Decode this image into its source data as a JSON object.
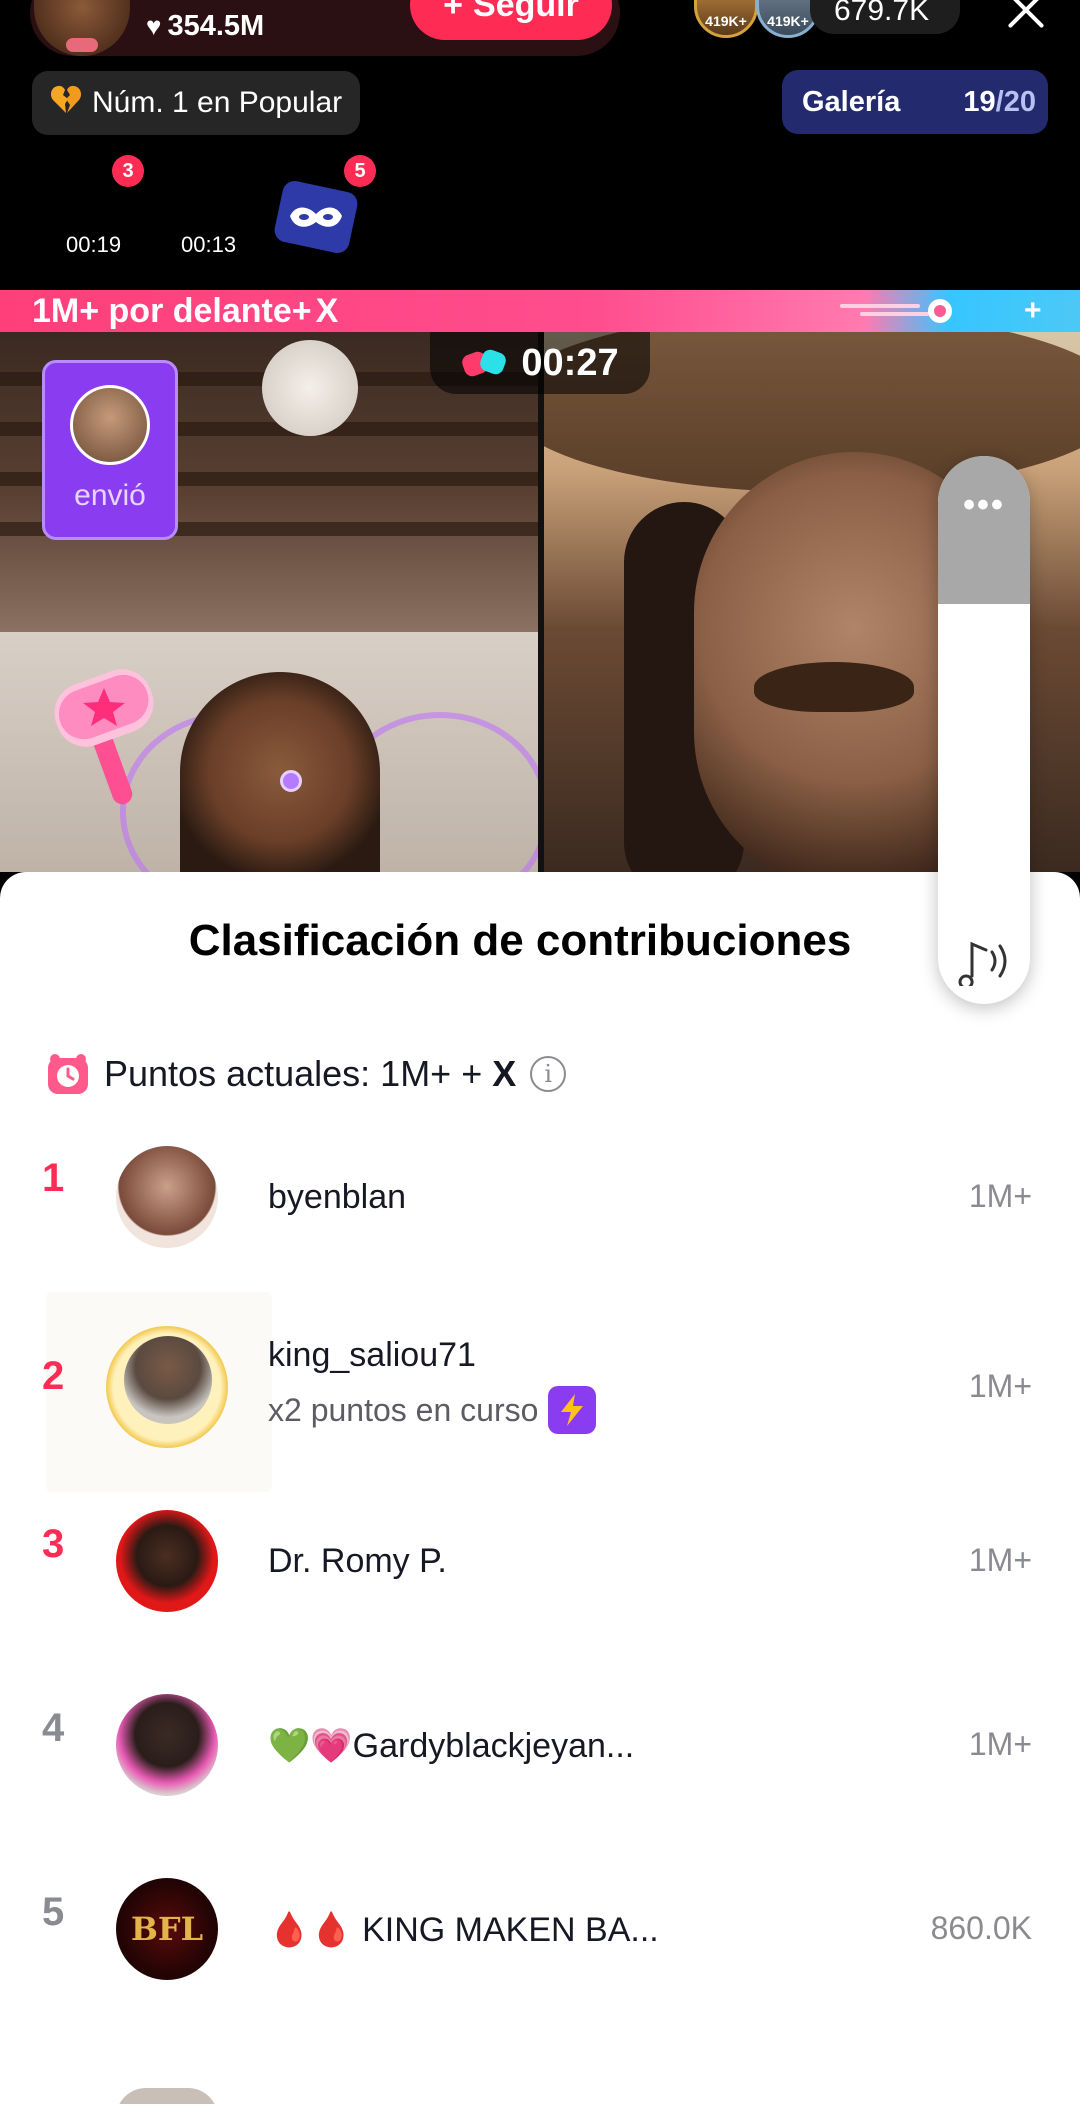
{
  "host": {
    "likes": "354.5M",
    "follow_label": "Seguir"
  },
  "viewers": {
    "badge_1": "419K+",
    "badge_2": "419K+",
    "count": "679.7K"
  },
  "popular_badge": {
    "label": "Núm. 1 en Popular"
  },
  "gallery": {
    "label": "Galería",
    "current": "19",
    "separator": "/",
    "total": "20"
  },
  "gift_timers": [
    {
      "time": "00:19",
      "badge": "3"
    },
    {
      "time": "00:13"
    },
    {
      "badge": "5",
      "icon": "mask-icon"
    }
  ],
  "progress_banner": {
    "text": "1M+ por delante+",
    "x_mark": "X",
    "plus": "+"
  },
  "battle": {
    "timer": "00:27",
    "sent_label": "envió"
  },
  "volume": {
    "dots": "•••",
    "level": 0.73
  },
  "sheet": {
    "title": "Clasificación de contribuciones",
    "points_label": "Puntos actuales: 1M+ +",
    "points_x": "X",
    "info_glyph": "i"
  },
  "ranking": [
    {
      "rank": "1",
      "name": "byenblan",
      "score": "1M+"
    },
    {
      "rank": "2",
      "name": "king_saliou71",
      "sub": "x2 puntos en curso",
      "score": "1M+"
    },
    {
      "rank": "3",
      "name": "Dr. Romy P.",
      "score": "1M+"
    },
    {
      "rank": "4",
      "name": "💚💗Gardyblackjeyan...",
      "score": "1M+"
    },
    {
      "rank": "5",
      "name": "🩸🩸 KING MAKEN BA...",
      "score": "860.0K",
      "avatar_text": "BFL"
    }
  ],
  "colors": {
    "accent": "#fe2c55",
    "gallery_bg": "#232a6e",
    "sent_card": "#8a3df0",
    "rank_top": "#fe2c55",
    "rank_rest": "#8a8b91"
  }
}
